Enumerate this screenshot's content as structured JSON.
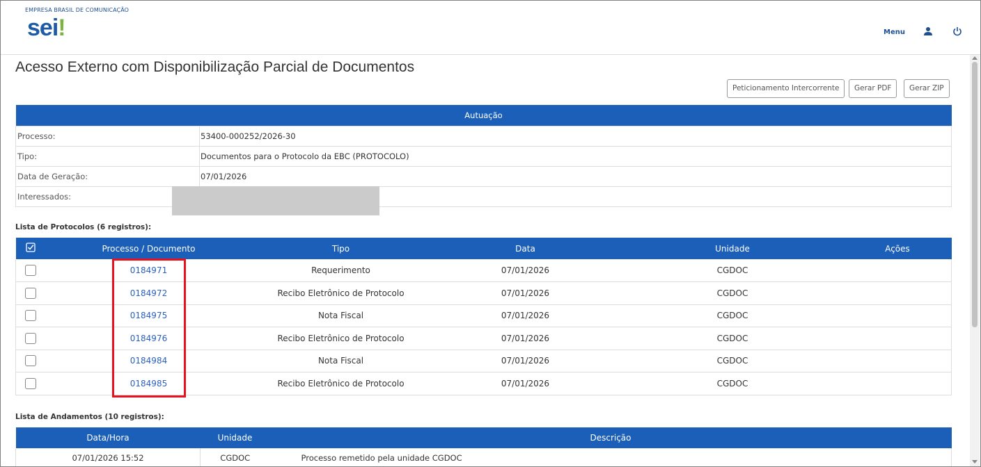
{
  "header": {
    "org": "EMPRESA BRASIL DE COMUNICAÇÃO",
    "logo": "sei",
    "logo_mark": "!",
    "menu_label": "Menu"
  },
  "page": {
    "title": "Acesso Externo com Disponibilização Parcial de Documentos",
    "buttons": {
      "peticionamento": "Peticionamento Intercorrente",
      "gerar_pdf": "Gerar PDF",
      "gerar_zip": "Gerar ZIP"
    }
  },
  "autuacao": {
    "heading": "Autuação",
    "rows": [
      {
        "label": "Processo:",
        "value": "53400-000252/2026-30"
      },
      {
        "label": "Tipo:",
        "value": "Documentos para o Protocolo da EBC (PROTOCOLO)"
      },
      {
        "label": "Data de Geração:",
        "value": "07/01/2026"
      },
      {
        "label": "Interessados:",
        "value": ""
      }
    ]
  },
  "protocolos": {
    "caption": "Lista de Protocolos (6 registros):",
    "columns": [
      "Processo / Documento",
      "Tipo",
      "Data",
      "Unidade",
      "Ações"
    ],
    "rows": [
      {
        "doc": "0184971",
        "tipo": "Requerimento",
        "data": "07/01/2026",
        "unidade": "CGDOC"
      },
      {
        "doc": "0184972",
        "tipo": "Recibo Eletrônico de Protocolo",
        "data": "07/01/2026",
        "unidade": "CGDOC"
      },
      {
        "doc": "0184975",
        "tipo": "Nota Fiscal",
        "data": "07/01/2026",
        "unidade": "CGDOC"
      },
      {
        "doc": "0184976",
        "tipo": "Recibo Eletrônico de Protocolo",
        "data": "07/01/2026",
        "unidade": "CGDOC"
      },
      {
        "doc": "0184984",
        "tipo": "Nota Fiscal",
        "data": "07/01/2026",
        "unidade": "CGDOC"
      },
      {
        "doc": "0184985",
        "tipo": "Recibo Eletrônico de Protocolo",
        "data": "07/01/2026",
        "unidade": "CGDOC"
      }
    ]
  },
  "andamentos": {
    "caption": "Lista de Andamentos (10 registros):",
    "columns": [
      "Data/Hora",
      "Unidade",
      "Descrição"
    ],
    "rows": [
      {
        "datahora": "07/01/2026 15:52",
        "unidade": "CGDOC",
        "descricao": "Processo remetido pela unidade CGDOC"
      }
    ]
  },
  "colors": {
    "header_blue": "#1b5fb8",
    "link_blue": "#2b5fbf",
    "highlight_red": "#e8111e"
  }
}
